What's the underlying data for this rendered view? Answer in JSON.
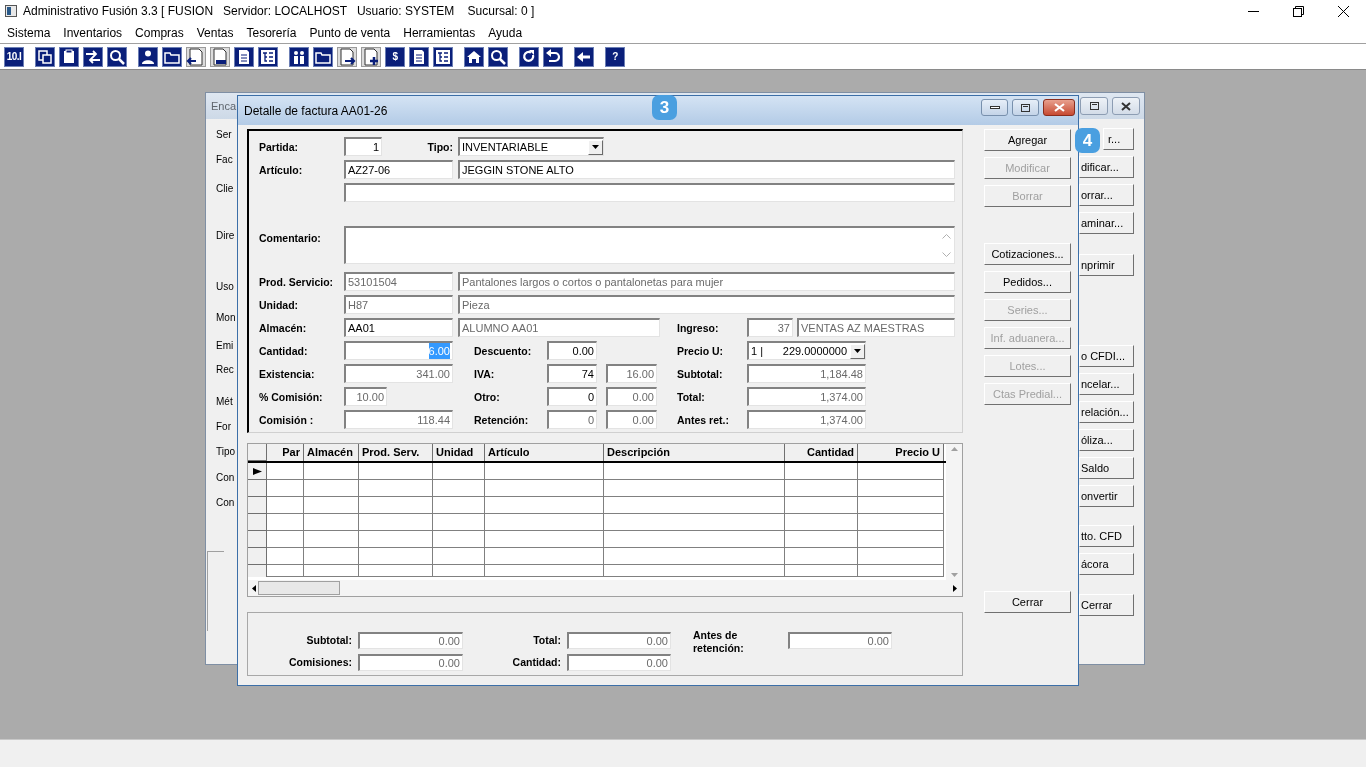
{
  "window": {
    "title": "Administrativo Fusión 3.3 [ FUSION   Servidor: LOCALHOST   Usuario: SYSTEM    Sucursal: 0 ]"
  },
  "menu": [
    "Sistema",
    "Inventarios",
    "Compras",
    "Ventas",
    "Tesorería",
    "Punto de venta",
    "Herramientas",
    "Ayuda"
  ],
  "toolbar": {
    "text_buttons": [
      "10.I",
      "$",
      "?"
    ]
  },
  "background_window": {
    "title": "Enca",
    "labels": [
      "Ser",
      "Fac",
      "Clie",
      "Dire",
      "Uso",
      "Mon",
      "Emi",
      "Rec",
      "Mét",
      "For",
      "Tipo",
      "Con",
      "Con"
    ],
    "button_groups": [
      [
        "r...",
        "dificar...",
        "orrar...",
        "aminar..."
      ],
      [
        "nprimir"
      ],
      [
        "o CFDI...",
        "ncelar...",
        "relación...",
        "óliza...",
        "Saldo",
        "onvertir"
      ],
      [
        "tto. CFD",
        "ácora"
      ],
      [
        "Cerrar"
      ]
    ]
  },
  "dialog": {
    "title": "Detalle de factura AA01-26",
    "form": {
      "partida": {
        "label": "Partida:",
        "fields": [
          {
            "value": "1",
            "disabled": false
          }
        ]
      },
      "tipo": {
        "label": "Tipo:",
        "fields": [
          {
            "value": "INVENTARIABLE",
            "disabled": false
          }
        ]
      },
      "articulo": {
        "label": "Artículo:",
        "fields": [
          {
            "value": "AZ27-06",
            "disabled": false
          },
          {
            "value": "JEGGIN STONE ALTO",
            "disabled": false
          }
        ]
      },
      "comentario": {
        "label": "Comentario:"
      },
      "prod_servicio": {
        "label": "Prod. Servicio:",
        "fields": [
          {
            "value": "53101504",
            "disabled": true
          },
          {
            "value": "Pantalones largos o cortos o pantalonetas para mujer",
            "disabled": true
          }
        ]
      },
      "unidad": {
        "label": "Unidad:",
        "fields": [
          {
            "value": "H87",
            "disabled": true
          },
          {
            "value": "Pieza",
            "disabled": true
          }
        ]
      },
      "almacen": {
        "label": "Almacén:",
        "fields": [
          {
            "value": "AA01",
            "disabled": false
          },
          {
            "value": "ALUMNO AA01",
            "disabled": true
          }
        ]
      },
      "ingreso": {
        "label": "Ingreso:",
        "fields": [
          {
            "value": "37",
            "disabled": true
          },
          {
            "value": "VENTAS AZ MAESTRAS",
            "disabled": true
          }
        ]
      },
      "cantidad": {
        "label": "Cantidad:",
        "fields": [
          {
            "value": "6.00",
            "disabled": false,
            "highlighted": true
          }
        ]
      },
      "descuento": {
        "label": "Descuento:",
        "fields": [
          {
            "value": "0.00",
            "disabled": false
          }
        ]
      },
      "precio_u": {
        "label": "Precio U:",
        "fields": [
          {
            "prefix": "1 |",
            "value": "229.0000000",
            "disabled": false
          }
        ]
      },
      "existencia": {
        "label": "Existencia:",
        "fields": [
          {
            "value": "341.00",
            "disabled": true
          }
        ]
      },
      "iva": {
        "label": "IVA:",
        "fields": [
          {
            "value": "74",
            "disabled": false
          },
          {
            "value": "16.00",
            "disabled": true
          }
        ]
      },
      "subtotal": {
        "label": "Subtotal:",
        "fields": [
          {
            "value": "1,184.48",
            "disabled": true
          }
        ]
      },
      "comision_pct": {
        "label": "% Comisión:",
        "fields": [
          {
            "value": "10.00",
            "disabled": true
          }
        ]
      },
      "otro": {
        "label": "Otro:",
        "fields": [
          {
            "value": "0",
            "disabled": false
          },
          {
            "value": "0.00",
            "disabled": true
          }
        ]
      },
      "total": {
        "label": "Total:",
        "fields": [
          {
            "value": "1,374.00",
            "disabled": true
          }
        ]
      },
      "comision": {
        "label": "Comisión :",
        "fields": [
          {
            "value": "118.44",
            "disabled": true
          }
        ]
      },
      "retencion": {
        "label": "Retención:",
        "fields": [
          {
            "value": "0",
            "disabled": true
          },
          {
            "value": "0.00",
            "disabled": true
          }
        ]
      },
      "antes_ret": {
        "label": "Antes ret.:",
        "fields": [
          {
            "value": "1,374.00",
            "disabled": true
          }
        ]
      }
    },
    "grid": {
      "columns": [
        {
          "label": "Par"
        },
        {
          "label": "Almacén"
        },
        {
          "label": "Prod. Serv."
        },
        {
          "label": "Unidad"
        },
        {
          "label": "Artículo"
        },
        {
          "label": "Descripción"
        },
        {
          "label": "Cantidad"
        },
        {
          "label": "Precio U"
        }
      ],
      "rows": [
        {
          "current": true
        },
        {
          "current": false
        },
        {
          "current": false
        },
        {
          "current": false
        },
        {
          "current": false
        },
        {
          "current": false
        },
        {
          "current": false
        }
      ]
    },
    "totals": [
      {
        "label": "Subtotal:",
        "value": "0.00"
      },
      {
        "label": "Total:",
        "value": "0.00"
      },
      {
        "label": "Antes de retención:",
        "value": "0.00"
      },
      {
        "label": "Comisiones:",
        "value": "0.00"
      },
      {
        "label": "Cantidad:",
        "value": "0.00"
      }
    ],
    "button_groups": [
      [
        {
          "label": "Agregar",
          "disabled": false
        },
        {
          "label": "Modificar",
          "disabled": true
        },
        {
          "label": "Borrar",
          "disabled": true
        }
      ],
      [
        {
          "label": "Cotizaciones...",
          "disabled": false
        },
        {
          "label": "Pedidos...",
          "disabled": false
        },
        {
          "label": "Series...",
          "disabled": true
        },
        {
          "label": "Inf. aduanera...",
          "disabled": true
        },
        {
          "label": "Lotes...",
          "disabled": true
        },
        {
          "label": "Ctas Predial...",
          "disabled": true
        }
      ],
      [
        {
          "label": "Cerrar",
          "disabled": false
        }
      ]
    ]
  },
  "annotations": [
    {
      "label": "3"
    },
    {
      "label": "4"
    }
  ]
}
